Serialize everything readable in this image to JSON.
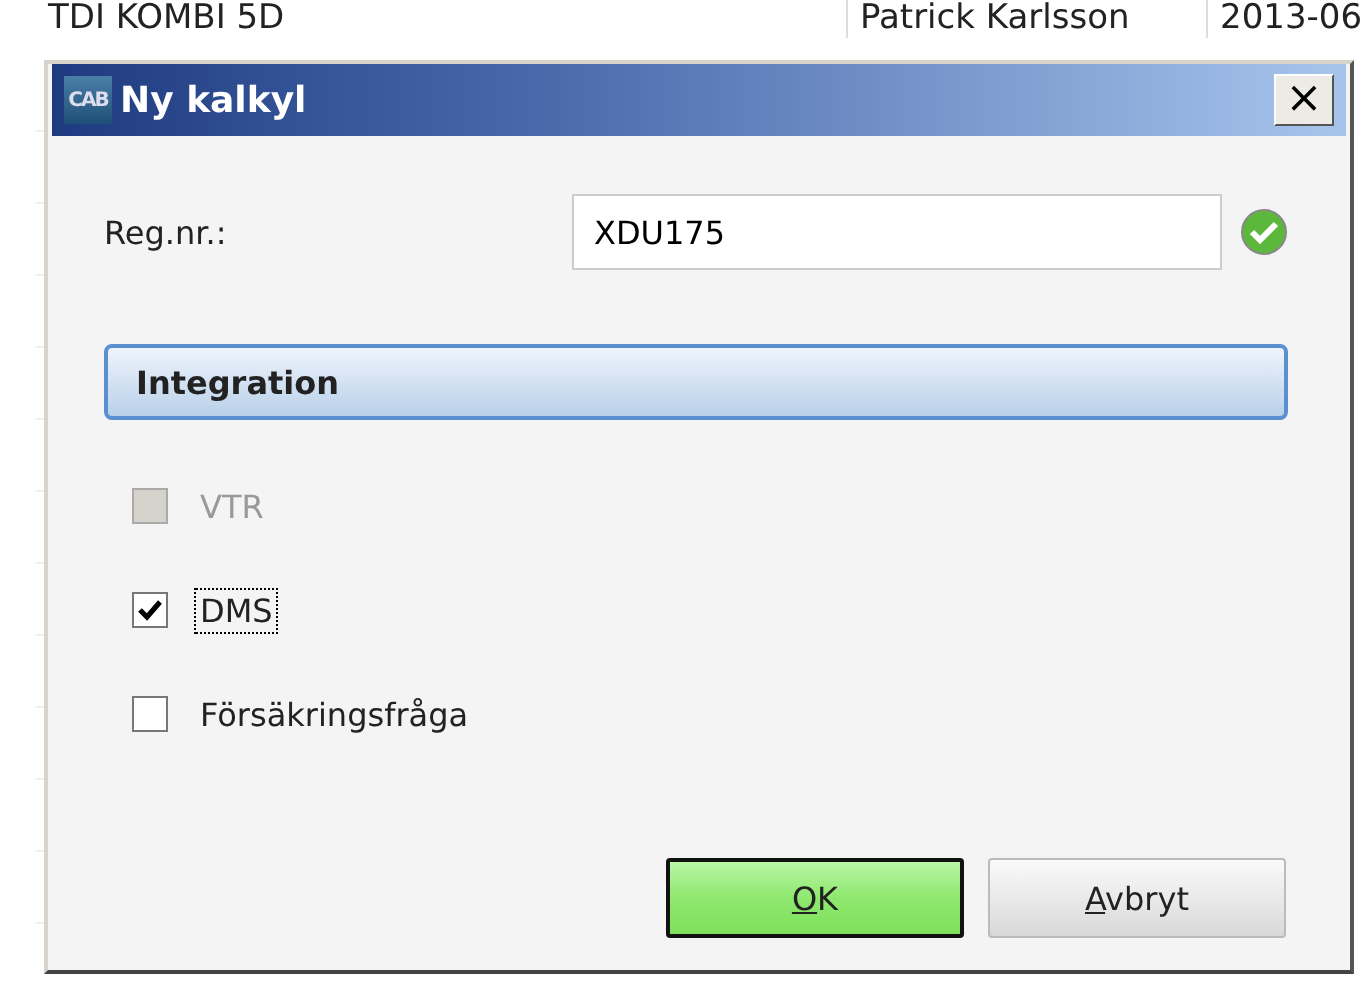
{
  "background_table": {
    "top_row": {
      "column_1": "TDI KOMBI 5D",
      "column_2": "Patrick Karlsson",
      "column_3": "2013-06"
    }
  },
  "dialog": {
    "title": "Ny kalkyl",
    "app_badge": "CAB",
    "close": "×",
    "reg_field": {
      "label": "Reg.nr.:",
      "value": "XDU175",
      "valid": true
    },
    "section": "Integration",
    "options": [
      {
        "label": "VTR",
        "checked": false,
        "disabled": true,
        "focused": false
      },
      {
        "label": "DMS",
        "checked": true,
        "disabled": false,
        "focused": true
      },
      {
        "label": "Försäkringsfråga",
        "checked": false,
        "disabled": false,
        "focused": false
      }
    ],
    "buttons": [
      {
        "label": "OK",
        "default": true
      },
      {
        "label": "Avbryt",
        "default": false
      }
    ]
  }
}
